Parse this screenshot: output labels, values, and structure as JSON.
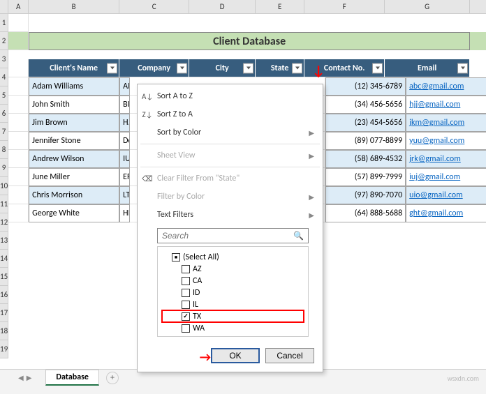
{
  "title": "Client Database",
  "columns": [
    "A",
    "B",
    "C",
    "D",
    "E",
    "F",
    "G"
  ],
  "rows": [
    "1",
    "2",
    "3",
    "4",
    "5",
    "6",
    "7",
    "8",
    "9",
    "10",
    "11",
    "12",
    "13",
    "14",
    "15",
    "16",
    "17",
    "18",
    "19"
  ],
  "headers": {
    "name": "Client's Name",
    "company": "Company",
    "city": "City",
    "state": "State",
    "contact": "Contact No.",
    "email": "Email"
  },
  "data": [
    {
      "name": "Adam Williams",
      "company": "AI",
      "contact": "(12) 345-6789",
      "email": "abc@gmail.com"
    },
    {
      "name": "John Smith",
      "company": "BI",
      "contact": "(34) 456-5656",
      "email": "hjj@gmail.com"
    },
    {
      "name": "Jim Brown",
      "company": "H.",
      "contact": "(23) 454-5656",
      "email": "jkm@gmail.com"
    },
    {
      "name": "Jennifer Stone",
      "company": "Dc",
      "contact": "(89) 077-8899",
      "email": "yuu@gmail.com"
    },
    {
      "name": "Andrew Wilson",
      "company": "IU",
      "contact": "(58) 689-4532",
      "email": "jrk@gmail.com"
    },
    {
      "name": "June Miller",
      "company": "EF",
      "contact": "(57) 899-7999",
      "email": "iuj@gmail.com"
    },
    {
      "name": "Chris Morrison",
      "company": "LT",
      "contact": "(97) 890-7070",
      "email": "uio@gmail.com"
    },
    {
      "name": "George White",
      "company": "HI",
      "contact": "(64) 888-5688",
      "email": "ght@gmail.com"
    }
  ],
  "menu": {
    "sort_az": "Sort A to Z",
    "sort_za": "Sort Z to A",
    "sort_color": "Sort by Color",
    "sheet_view": "Sheet View",
    "clear_filter": "Clear Filter From \"State\"",
    "filter_color": "Filter by Color",
    "text_filters": "Text Filters",
    "search_placeholder": "Search",
    "items": {
      "select_all": "(Select All)",
      "az": "AZ",
      "ca": "CA",
      "id": "ID",
      "il": "IL",
      "tx": "TX",
      "wa": "WA"
    },
    "ok": "OK",
    "cancel": "Cancel"
  },
  "sheet_tab": "Database",
  "watermark": "wsxdn.com"
}
